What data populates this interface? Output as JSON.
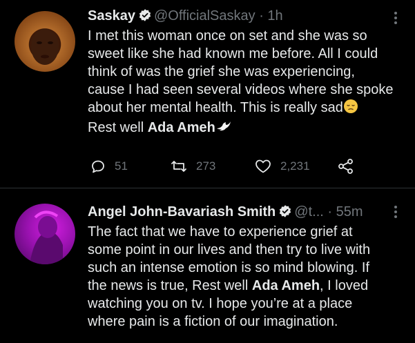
{
  "tweets": [
    {
      "author_name": "Saskay",
      "author_handle": "@OfficialSaskay",
      "time": "· 1h",
      "text_lines": [
        "I met this woman once on set and she was so",
        "sweet like she had known me before. All I could",
        "think of was the grief she was experiencing,",
        "cause I had seen several videos where she spoke",
        "about her mental health. This is really sad"
      ],
      "rest_prefix": "Rest well ",
      "rest_bold": "Ada Ameh",
      "replies": "51",
      "retweets": "273",
      "likes": "2,231"
    },
    {
      "author_name": "Angel John-Bavariash Smith",
      "author_handle": "@t...",
      "time": "· 55m",
      "line1": "The fact that we have to experience grief at",
      "line2": "some point in our lives and then try to live with",
      "line3": "such an intense emotion is so mind blowing. If",
      "line4_prefix": "the news is true, Rest well ",
      "line4_bold": "Ada Ameh",
      "line4_suffix": ", I loved",
      "line5": "watching you on tv. I hope you’re at a place",
      "line6": "where pain is a fiction of our imagination."
    }
  ],
  "colors": {
    "background": "#000000",
    "text": "#e7e9ea",
    "muted": "#71767b",
    "verified_fill": "#e7e9ea"
  },
  "icons": [
    "verified-badge-icon",
    "more-options-icon",
    "reply-icon",
    "retweet-icon",
    "like-icon",
    "share-icon",
    "pensive-face-emoji",
    "dove-emoji"
  ]
}
